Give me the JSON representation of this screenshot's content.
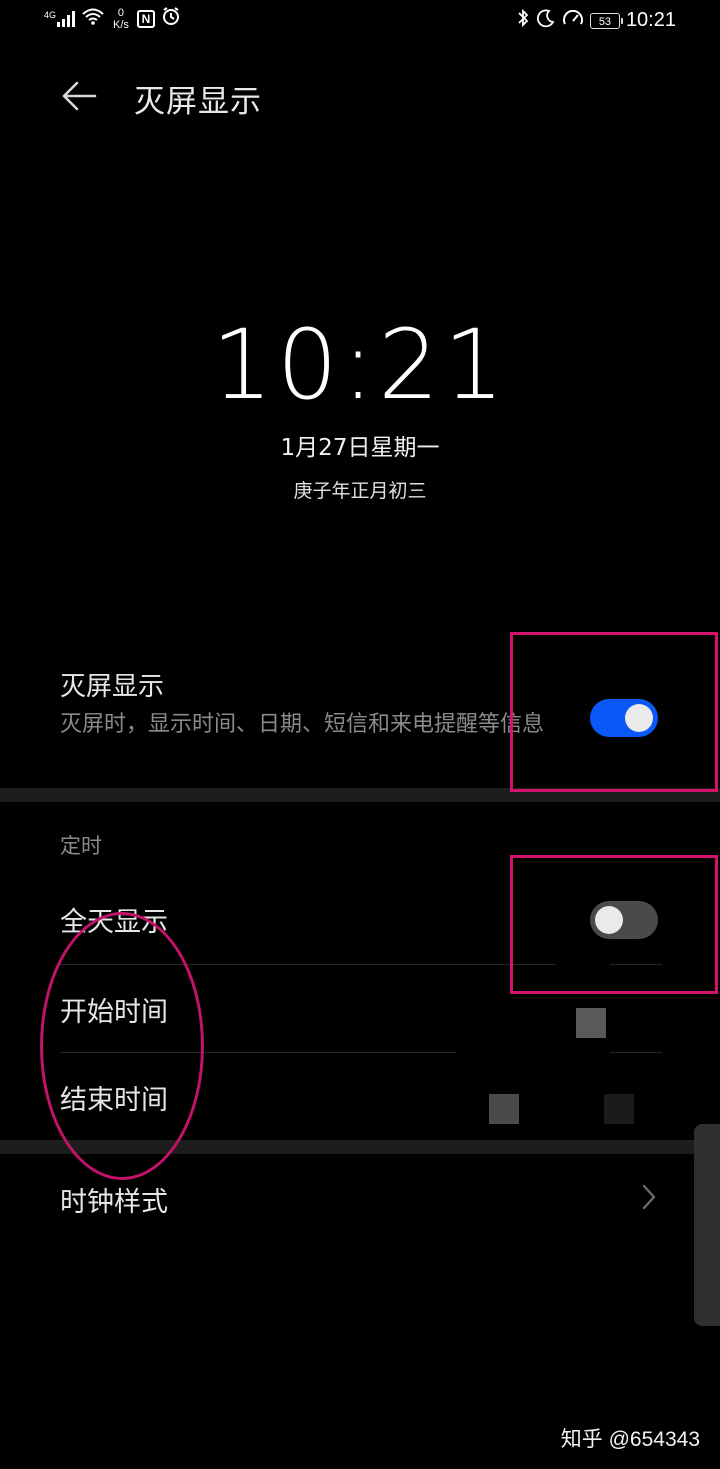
{
  "status_bar": {
    "network_type": "4G",
    "net_speed_value": "0",
    "net_speed_unit": "K/s",
    "nfc_label": "N",
    "battery_level": "53",
    "time": "10:21",
    "icons": [
      "signal-icon",
      "wifi-icon",
      "nfc-icon",
      "alarm-icon",
      "bluetooth-icon",
      "moon-icon",
      "speedometer-icon",
      "battery-icon"
    ]
  },
  "header": {
    "title": "灭屏显示"
  },
  "preview": {
    "time": "10:21",
    "date": "1月27日星期一",
    "lunar": "庚子年正月初三"
  },
  "main_toggle": {
    "title": "灭屏显示",
    "description": "灭屏时，显示时间、日期、短信和来电提醒等信息",
    "on": true
  },
  "schedule": {
    "section_label": "定时",
    "all_day_label": "全天显示",
    "all_day_on": false,
    "start_label": "开始时间",
    "end_label": "结束时间"
  },
  "clock_style": {
    "label": "时钟样式"
  },
  "watermark": "知乎 @654343",
  "colors": {
    "background": "#000000",
    "accent": "#0a59f7",
    "annotation": "#d0146b",
    "secondary_text": "#8a8a8a"
  }
}
